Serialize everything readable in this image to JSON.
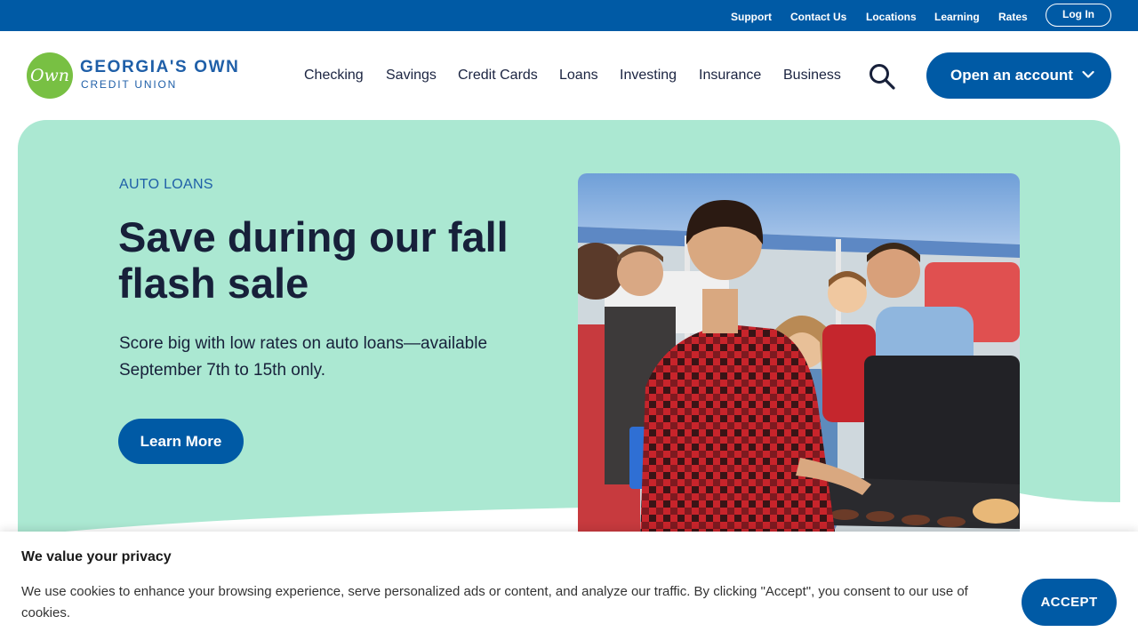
{
  "utility_nav": {
    "links": [
      "Support",
      "Contact Us",
      "Locations",
      "Learning",
      "Rates"
    ],
    "login_label": "Log In"
  },
  "header": {
    "logo": {
      "mark_text": "Own",
      "name": "GEORGIA'S OWN",
      "subtitle": "CREDIT UNION"
    },
    "nav": [
      "Checking",
      "Savings",
      "Credit Cards",
      "Loans",
      "Investing",
      "Insurance",
      "Business"
    ],
    "search_icon": "search-icon",
    "cta_label": "Open an account",
    "cta_icon": "chevron-down-icon"
  },
  "hero": {
    "eyebrow": "AUTO LOANS",
    "headline": "Save during our fall flash sale",
    "body": "Score big with low rates on auto loans—available September 7th to 15th only.",
    "button_label": "Learn More"
  },
  "cookie_banner": {
    "title": "We value your privacy",
    "text": "We use cookies to enhance your browsing experience, serve personalized ads or content, and analyze our traffic. By clicking \"Accept\", you consent to our use of cookies.",
    "accept_label": "ACCEPT"
  },
  "colors": {
    "brand_blue": "#005aa5",
    "hero_mint": "#abe8d2",
    "logo_green": "#78c043",
    "text_dark": "#17203a"
  }
}
